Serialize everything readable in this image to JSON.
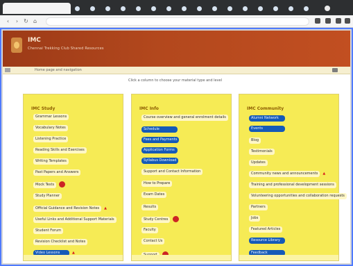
{
  "browser": {
    "tab_title": "",
    "address": ""
  },
  "header": {
    "brand_title": "IMC",
    "brand_subtitle": "Chennai Trekking Club Shared Resources"
  },
  "subnav": {
    "label": "Home page and navigation"
  },
  "intro": {
    "text": "Click a column to choose your material type and level"
  },
  "columns": [
    {
      "title": "IMC Study",
      "items": [
        "Grammar Lessons",
        "Vocabulary Notes",
        "Listening Practice",
        "Reading Skills and Exercises",
        "Writing Templates",
        "Past Papers and Answers",
        "Mock Tests",
        "Study Planner",
        "Official Guidance and Revision Notes",
        "Useful Links and Additional Support Materials",
        "Student Forum",
        "Revision Checklist and Notes",
        "Video Lessons"
      ]
    },
    {
      "title": "IMC Info",
      "items": [
        "Course overview and general enrolment details",
        "Schedule",
        "Fees and Payments",
        "Application Forms",
        "Syllabus Download",
        "Support and Contact Information",
        "How to Prepare",
        "Exam Dates",
        "Results",
        "Study Centres",
        "Faculty",
        "Contact Us",
        "Support"
      ]
    },
    {
      "title": "IMC Community",
      "items": [
        "Alumni Network",
        "Events",
        "Blog",
        "Testimonials",
        "Updates",
        "Community news and announcements",
        "Training and professional development sessions",
        "Volunteering opportunities and collaboration requests",
        "Partners",
        "Jobs",
        "Featured Articles",
        "Resource Library",
        "Feedback"
      ]
    }
  ]
}
